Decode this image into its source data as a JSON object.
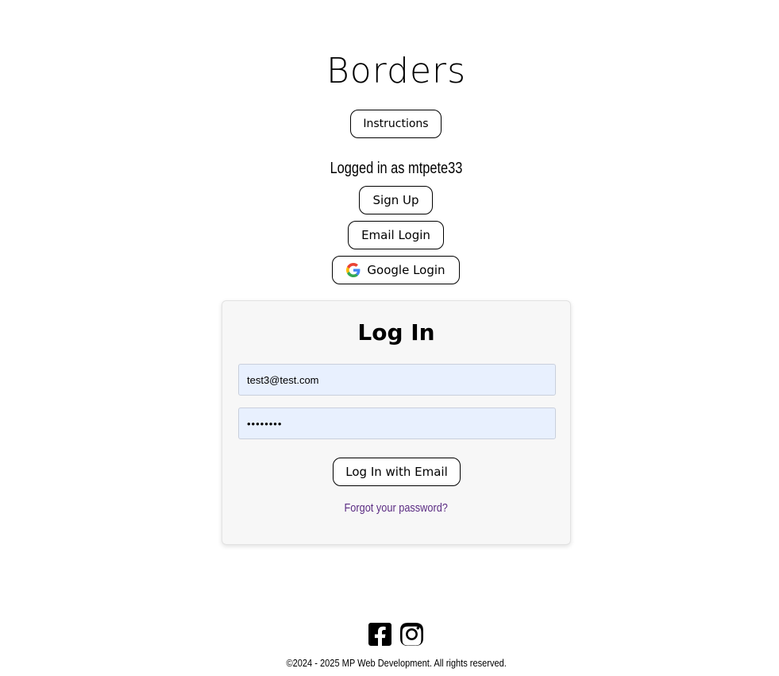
{
  "header": {
    "title": "Borders",
    "instructions_label": "Instructions"
  },
  "auth": {
    "status_text": "Logged in as mtpete33",
    "signup_label": "Sign Up",
    "email_login_label": "Email Login",
    "google_login_label": "Google Login"
  },
  "login_card": {
    "title": "Log In",
    "email_value": "test3@test.com",
    "password_value": "testtest",
    "submit_label": "Log In with Email",
    "forgot_link": "Forgot your password?"
  },
  "footer": {
    "social_icons": [
      "facebook-icon",
      "instagram-icon"
    ],
    "copyright": "©2024 - 2025 MP Web Development. All rights reserved."
  },
  "colors": {
    "input_bg": "#e8f0fe",
    "card_bg": "#f7f7f7",
    "link": "#5b2c83"
  }
}
